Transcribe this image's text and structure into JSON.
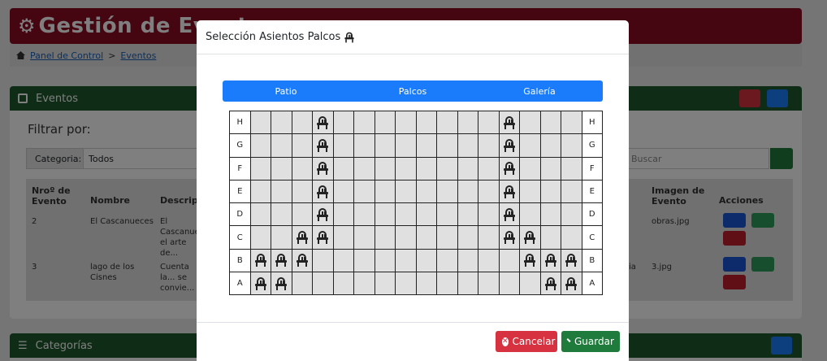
{
  "background": {
    "title": "Gestión de Eventos",
    "breadcrumb": [
      "Panel de Control",
      "Eventos"
    ],
    "eventos_card": {
      "title": "Eventos",
      "filter_title": "Filtrar por:",
      "category_label": "Categoria:",
      "category_value": "Todos",
      "search_placeholder": "Buscar",
      "columns": [
        "Nroº de Evento",
        "Nombre",
        "Descripción",
        "Imagen de Evento",
        "Acciones"
      ],
      "rows": [
        {
          "nro": "2",
          "nombre": "El Cascanueces",
          "descripcion": "El Cascanueces... el arte de...",
          "extra": "",
          "imagen": "obras.jpg"
        },
        {
          "nro": "3",
          "nombre": "lago de los Cisnes",
          "descripcion": "Cuenta la... se convie...",
          "extra": "ia",
          "imagen": "3.jpg"
        }
      ]
    },
    "categorias_card": {
      "title": "Categorías"
    }
  },
  "modal": {
    "title": "Selección Asientos Palcos",
    "tabs": [
      "Patio",
      "Palcos",
      "Galería"
    ],
    "seating": {
      "columns": 16,
      "rows": [
        {
          "label": "H",
          "seats": [
            4,
            13
          ]
        },
        {
          "label": "G",
          "seats": [
            4,
            13
          ]
        },
        {
          "label": "F",
          "seats": [
            4,
            13
          ]
        },
        {
          "label": "E",
          "seats": [
            4,
            13
          ]
        },
        {
          "label": "D",
          "seats": [
            4,
            13
          ]
        },
        {
          "label": "C",
          "seats": [
            3,
            4,
            13,
            14
          ]
        },
        {
          "label": "B",
          "seats": [
            1,
            2,
            3,
            14,
            15,
            16
          ]
        },
        {
          "label": "A",
          "seats": [
            1,
            2,
            15,
            16
          ]
        }
      ]
    },
    "cancel_label": "Cancelar",
    "save_label": "Guardar"
  },
  "colors": {
    "header": "#8b0c22",
    "card_header": "#1e5b2d",
    "tabs": "#1a7cfa",
    "cancel": "#d6323f",
    "save": "#1e7b3b"
  }
}
